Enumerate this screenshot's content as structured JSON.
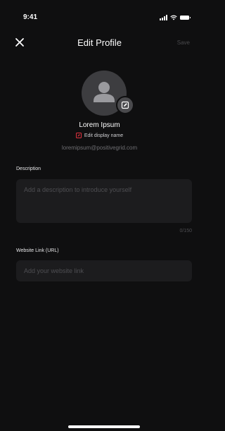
{
  "status_bar": {
    "time": "9:41"
  },
  "nav": {
    "title": "Edit Profile",
    "save_label": "Save"
  },
  "profile": {
    "name": "Lorem Ipsum",
    "edit_name_label": "Edit display name",
    "email": "loremipsum@positivegrid.com"
  },
  "description": {
    "label": "Description",
    "placeholder": "Add a description to introduce yourself",
    "counter": "0/150"
  },
  "website": {
    "label": "Website Link (URL)",
    "placeholder": "Add your website link"
  },
  "colors": {
    "background": "#0f0f10",
    "input_background": "#1c1c1e",
    "accent_red": "#e0313e",
    "muted_text": "#4e4e52"
  },
  "icons": {
    "close": "close-icon",
    "avatar": "person-icon",
    "edit_avatar": "edit-icon",
    "edit_name": "edit-name-icon"
  }
}
